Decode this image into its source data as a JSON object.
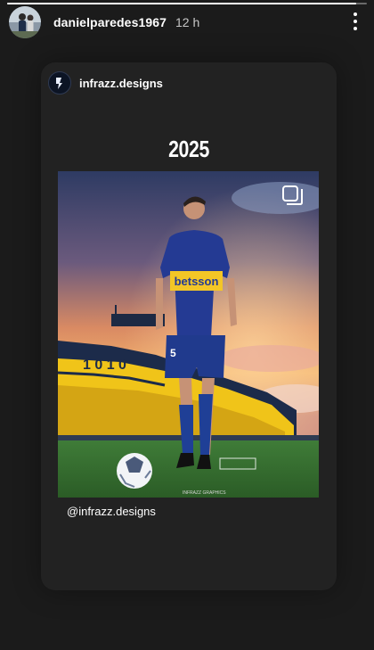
{
  "story": {
    "progress": 0.97,
    "username": "danielparedes1967",
    "time": "12 h",
    "more_icon": "more-vertical-icon"
  },
  "post": {
    "username": "infrazz.designs",
    "heading": "2025",
    "image": {
      "sponsor_text": "betsson",
      "jersey_number": "5",
      "multi_icon": "carousel-icon"
    },
    "mention": "@infrazz.designs"
  }
}
